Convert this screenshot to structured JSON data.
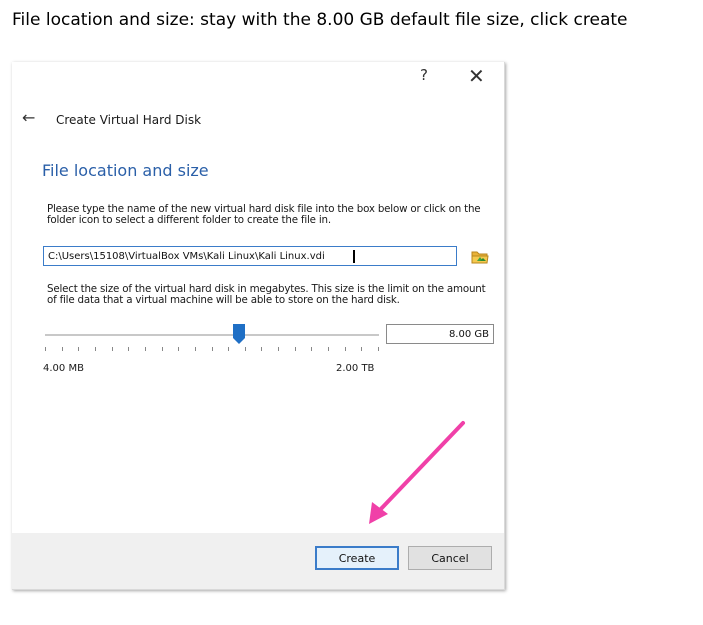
{
  "caption": "File location and size:  stay with the 8.00 GB default file size, click create",
  "dialog": {
    "help_label": "?",
    "close_label": "✕",
    "back_label": "←",
    "title": "Create Virtual Hard Disk",
    "section_heading": "File location and size",
    "location_description": "Please type the name of the new virtual hard disk file into the box below or click on the folder icon to select a different folder to create the file in.",
    "file_path": "C:\\Users\\15108\\VirtualBox VMs\\Kali Linux\\Kali Linux.vdi",
    "size_description": "Select the size of the virtual hard disk in megabytes. This size is the limit on the amount of file data that a virtual machine will be able to store on the hard disk.",
    "slider_position": 0.58,
    "size_value": "8.00 GB",
    "min_label": "4.00 MB",
    "max_label": "2.00 TB",
    "create_label": "Create",
    "cancel_label": "Cancel"
  },
  "colors": {
    "accent": "#2a5fa8",
    "focus_border": "#3b7cc9",
    "slider_handle": "#1f6fc5",
    "annotation_arrow": "#f040a8"
  }
}
